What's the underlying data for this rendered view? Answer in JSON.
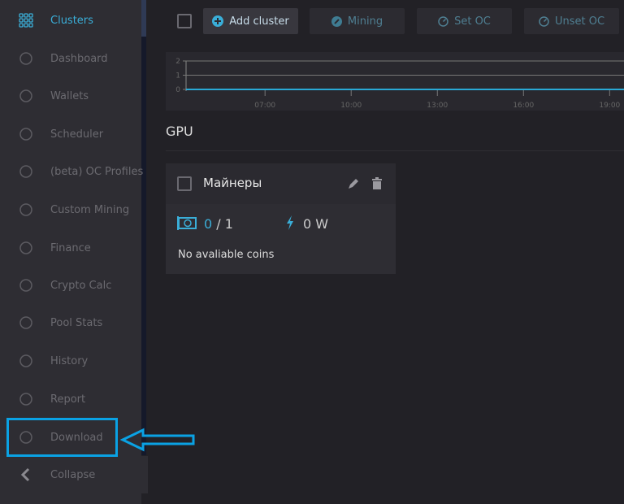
{
  "sidebar": {
    "items": [
      {
        "label": "Clusters",
        "icon": "grid-icon",
        "active": true
      },
      {
        "label": "Dashboard",
        "icon": "speedometer-icon"
      },
      {
        "label": "Wallets",
        "icon": "wallet-icon"
      },
      {
        "label": "Scheduler",
        "icon": "calendar-clock-icon"
      },
      {
        "label": "(beta) OC Profiles",
        "icon": "gauge-icon"
      },
      {
        "label": "Custom Mining",
        "icon": "gear-icon"
      },
      {
        "label": "Finance",
        "icon": "coins-icon"
      },
      {
        "label": "Crypto Calc",
        "icon": "calculator-icon"
      },
      {
        "label": "Pool Stats",
        "icon": "pool-icon"
      },
      {
        "label": "History",
        "icon": "history-icon"
      },
      {
        "label": "Report",
        "icon": "report-chart-icon"
      },
      {
        "label": "Download",
        "icon": "download-icon"
      },
      {
        "label": "Collapse",
        "icon": "chevron-left-icon"
      }
    ]
  },
  "toolbar": {
    "add_cluster": "Add cluster",
    "mining": "Mining",
    "set_oc": "Set OC",
    "unset_oc": "Unset OC"
  },
  "chart_data": {
    "type": "line",
    "yticks": [
      "0",
      "1",
      "2"
    ],
    "ylim": [
      0,
      2
    ],
    "xticks": [
      "07:00",
      "10:00",
      "13:00",
      "16:00",
      "19:00"
    ],
    "xlim": [
      "04:15",
      "19:30"
    ],
    "series": [
      {
        "color": "#29a9d6",
        "x": [
          "04:15",
          "19:30"
        ],
        "y": [
          0,
          0
        ]
      }
    ],
    "grid": true
  },
  "section": {
    "title": "GPU"
  },
  "card": {
    "name": "Майнеры",
    "gpu_online": "0",
    "gpu_total": " / 1",
    "power": "0 W",
    "coins": "No avaliable coins"
  },
  "colors": {
    "accent": "#3aaed8",
    "highlight": "#0aa2e4"
  }
}
